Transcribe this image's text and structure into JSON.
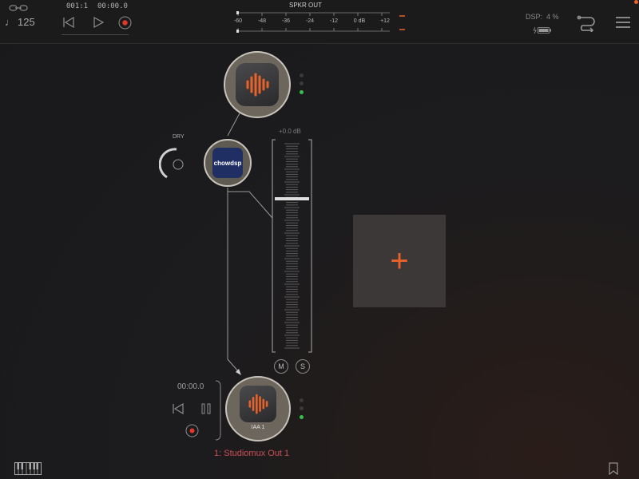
{
  "top": {
    "tempo": "125",
    "position_bars": "001:1",
    "position_time": "00:00.0",
    "output_label": "SPKR OUT",
    "meter_ticks": [
      "-60",
      "-48",
      "-36",
      "-24",
      "-12",
      "0 dB",
      "+12"
    ],
    "dsp_label": "DSP:  4 %"
  },
  "chain": {
    "dry_label": "DRY",
    "effect_name": "chowdsp",
    "fader_db": "+0.0 dB",
    "mute_label": "M",
    "solo_label": "S",
    "add_plus_symbol": "+",
    "fader_level": 0.73
  },
  "output_node": {
    "time": "00:00.0",
    "name": "IAA 1",
    "route_label": "1: Studiomux Out 1"
  },
  "colors": {
    "accent_orange": "#e8622c",
    "record_red": "#e0392b",
    "route_red": "#c94f57",
    "led_green": "#34c24a"
  }
}
